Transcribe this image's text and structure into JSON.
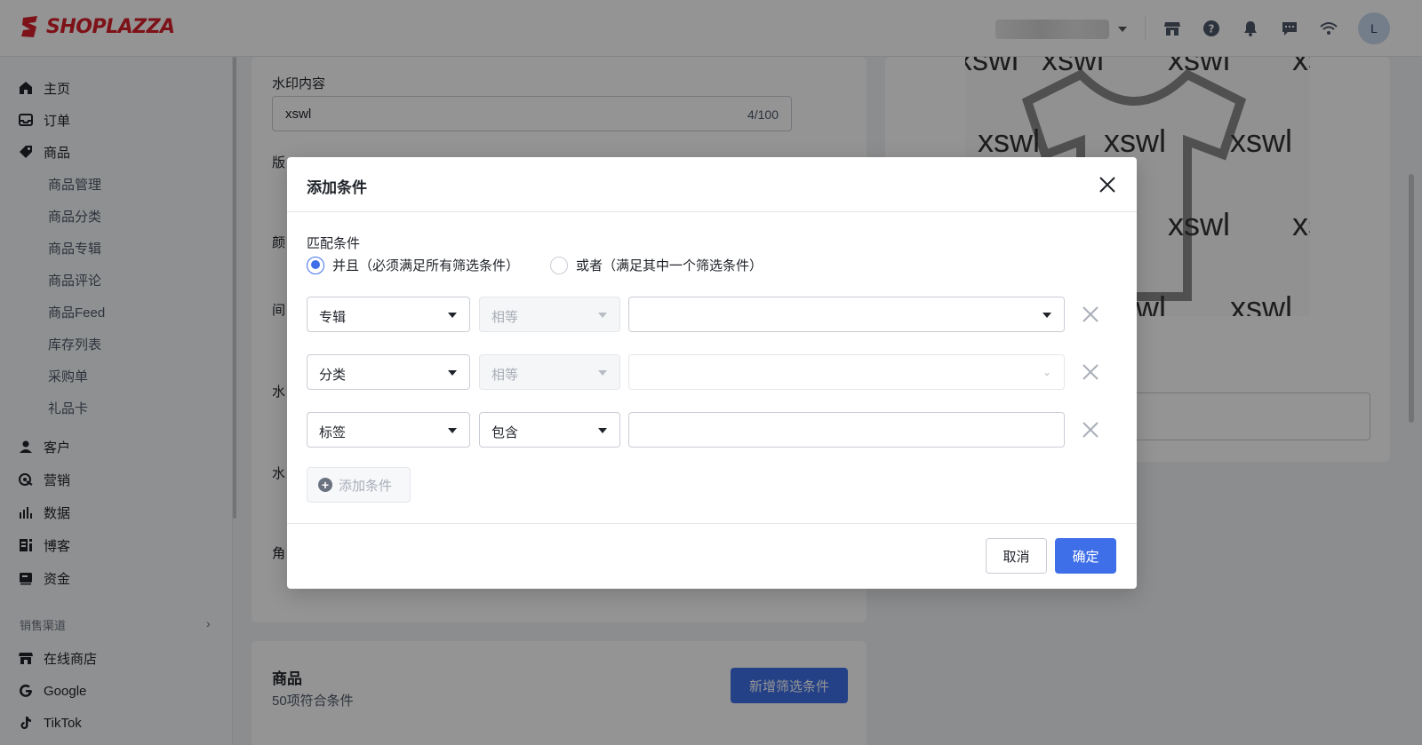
{
  "brand": {
    "name": "SHOPLAZZA",
    "color": "#d8202b"
  },
  "topbar": {
    "icons": [
      "store-icon",
      "help-icon",
      "bell-icon",
      "message-icon",
      "wifi-icon"
    ],
    "avatar_initial": "L"
  },
  "sidebar": {
    "items": [
      {
        "label": "主页",
        "icon": "home-icon"
      },
      {
        "label": "订单",
        "icon": "inbox-icon"
      },
      {
        "label": "商品",
        "icon": "tag-icon"
      }
    ],
    "product_sub": [
      "商品管理",
      "商品分类",
      "商品专辑",
      "商品评论",
      "商品Feed",
      "库存列表",
      "采购单",
      "礼品卡"
    ],
    "items2": [
      {
        "label": "客户",
        "icon": "user-icon"
      },
      {
        "label": "营销",
        "icon": "marketing-icon"
      },
      {
        "label": "数据",
        "icon": "chart-icon"
      },
      {
        "label": "博客",
        "icon": "blog-icon"
      },
      {
        "label": "资金",
        "icon": "wallet-icon"
      }
    ],
    "section_label": "销售渠道",
    "channels": [
      {
        "label": "在线商店",
        "icon": "store-icon"
      },
      {
        "label": "Google",
        "icon": "google-icon"
      },
      {
        "label": "TikTok",
        "icon": "tiktok-icon"
      }
    ]
  },
  "background": {
    "watermark_label": "水印内容",
    "watermark_value": "xswl",
    "watermark_count": "4/100",
    "label_partials": [
      "版",
      "颜",
      "间",
      "水",
      "水",
      "角"
    ],
    "watermark_text": "xswl",
    "products_title": "商品",
    "products_count": "50项符合条件",
    "new_filter_button": "新增筛选条件"
  },
  "modal": {
    "title": "添加条件",
    "match_label": "匹配条件",
    "radio_and": "并且（必须满足所有筛选条件）",
    "radio_or": "或者（满足其中一个筛选条件）",
    "selected": "and",
    "rows": [
      {
        "field": "专辑",
        "operator": "相等",
        "value": ""
      },
      {
        "field": "分类",
        "operator": "相等",
        "value": ""
      },
      {
        "field": "标签",
        "operator": "包含",
        "value": ""
      }
    ],
    "add_condition": "添加条件",
    "cancel": "取消",
    "confirm": "确定"
  },
  "colors": {
    "primary": "#3f6fe8"
  }
}
